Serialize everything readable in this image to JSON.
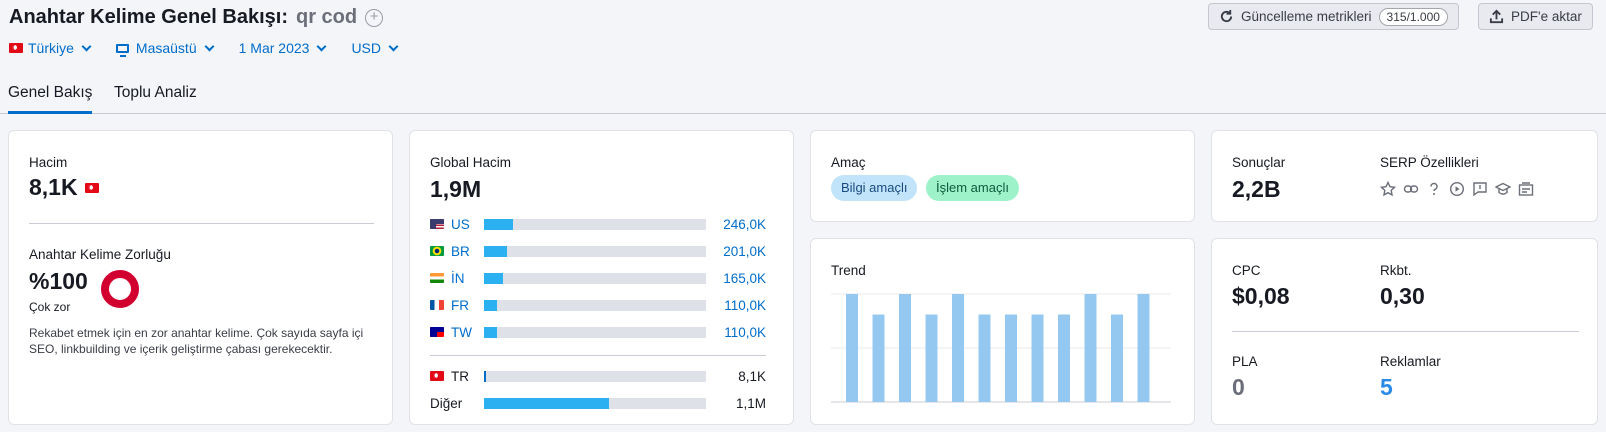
{
  "header": {
    "title": "Anahtar Kelime Genel Bakışı:",
    "keyword": "qr cod",
    "filters": {
      "country": "Türkiye",
      "device": "Masaüstü",
      "date": "1 Mar 2023",
      "currency": "USD"
    },
    "update_button": "Güncelleme metrikleri",
    "update_count": "315/1.000",
    "pdf_button": "PDF'e aktar"
  },
  "tabs": [
    {
      "label": "Genel Bakış",
      "active": true
    },
    {
      "label": "Toplu Analiz",
      "active": false
    }
  ],
  "volume": {
    "label": "Hacim",
    "value": "8,1K"
  },
  "kd": {
    "label": "Anahtar Kelime Zorluğu",
    "value": "%100",
    "level": "Çok zor",
    "percent": 100,
    "description": "Rekabet etmek için en zor anahtar kelime. Çok sayıda sayfa içi SEO, linkbuilding ve içerik geliştirme çabası gerekecektir.",
    "ring_color": "#d1002f"
  },
  "global_volume": {
    "label": "Global Hacim",
    "value": "1,9M",
    "countries": [
      {
        "code": "US",
        "value": "246,0K",
        "share": 0.13
      },
      {
        "code": "BR",
        "value": "201,0K",
        "share": 0.105
      },
      {
        "code": "İN",
        "value": "165,0K",
        "share": 0.087
      },
      {
        "code": "FR",
        "value": "110,0K",
        "share": 0.058
      },
      {
        "code": "TW",
        "value": "110,0K",
        "share": 0.058
      }
    ],
    "local": {
      "code": "TR",
      "value": "8,1K",
      "share": 0.01
    },
    "other": {
      "label": "Diğer",
      "value": "1,1M",
      "share": 0.565
    },
    "bar_color": "#2bb0f2"
  },
  "intent": {
    "label": "Amaç",
    "tags": [
      "Bilgi amaçlı",
      "İşlem amaçlı"
    ]
  },
  "trend": {
    "label": "Trend",
    "bar_color": "#95c8f0"
  },
  "chart_data": {
    "type": "bar",
    "values": [
      1.0,
      0.81,
      1.0,
      0.81,
      1.0,
      0.81,
      0.81,
      0.81,
      0.81,
      1.0,
      0.81,
      1.0
    ],
    "ylim": [
      0,
      1
    ]
  },
  "results": {
    "label": "Sonuçlar",
    "value": "2,2B"
  },
  "serp": {
    "label": "SERP Özellikleri",
    "icons": [
      "star-icon",
      "link-icon",
      "question-icon",
      "video-icon",
      "review-icon",
      "education-icon",
      "news-icon"
    ]
  },
  "cpc": {
    "label": "CPC",
    "value": "$0,08"
  },
  "competition": {
    "label": "Rkbt.",
    "value": "0,30"
  },
  "pla": {
    "label": "PLA",
    "value": "0"
  },
  "ads": {
    "label": "Reklamlar",
    "value": "5"
  }
}
